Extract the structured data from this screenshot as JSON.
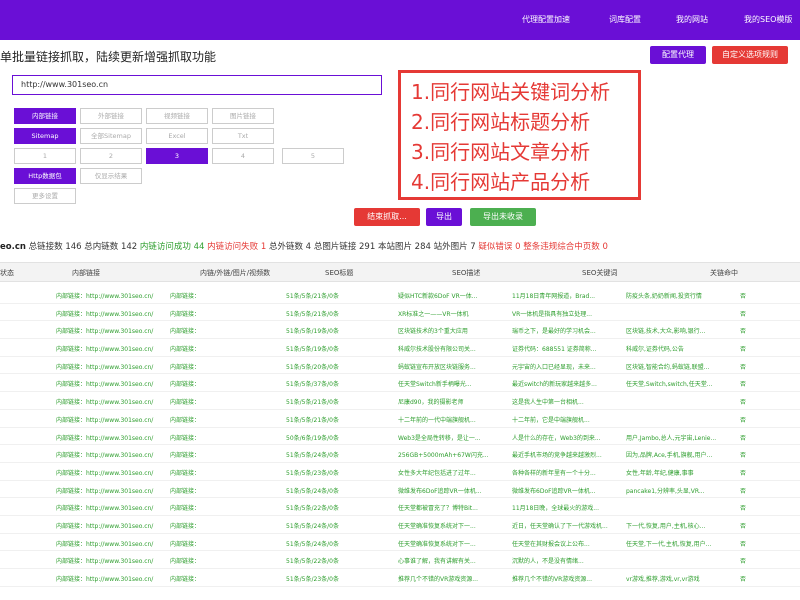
{
  "nav": [
    "代理配置加速",
    "词库配置",
    "我的网站",
    "我的SEO模版"
  ],
  "headline": "单批量链接抓取，陆续更新增强抓取功能",
  "header_buttons": [
    "配置代理",
    "自定义选项规则"
  ],
  "url_input": "http://www.301seo.cn",
  "options": [
    [
      "内部链接",
      "外部链接",
      "视频链接",
      "图片链接"
    ],
    [
      "Sitemap",
      "全部Sitemap",
      "Excel",
      "Txt"
    ],
    [
      "1",
      "2",
      "3",
      "4",
      "5"
    ],
    [
      "Http数据包",
      "仅显示结果"
    ],
    [
      "更多设置"
    ]
  ],
  "features": [
    "1.同行网站关键词分析",
    "2.同行网站标题分析",
    "3.同行网站文章分析",
    "4.同行网站产品分析"
  ],
  "actions": [
    "结束抓取...",
    "导出",
    "导出未收录"
  ],
  "stats": {
    "domain": "eo.cn",
    "total_links": "总链接数 146",
    "internal_links": "总内链数 142",
    "internal_ok": "内链访问成功 44",
    "internal_fail": "内链访问失败 1",
    "external_links": "总外链数 4",
    "total_images": "总图片链接 291",
    "site_images": "本站图片 284",
    "offsite_images": "站外图片 7",
    "suspected_404": "疑似错误 0",
    "duplicate": "整条违规综合中页数 0"
  },
  "table": {
    "headers": [
      "状态",
      "内部链接",
      "内链/外链/图片/视频数",
      "SEO标题",
      "SEO描述",
      "SEO关键词",
      "关链命中"
    ],
    "rows": [
      [
        "内部链接：http://www.301seo.cn/",
        "内部链接：",
        "51条/5条/21条/0条",
        "疑似HTC新款6DoF VR一体...",
        "11月18日青年网报道，Brad...",
        "防疫头条,奶奶新闻,投资行情",
        "否"
      ],
      [
        "内部链接：http://www.301seo.cn/",
        "内部链接：",
        "51条/5条/21条/0条",
        "XR标准之一——VR一体机",
        "VR一体机是指具有独立处理...",
        "",
        "否"
      ],
      [
        "内部链接：http://www.301seo.cn/",
        "内部链接：",
        "51条/5条/19条/0条",
        "区块链技术的3个重大应用",
        "瑞币之下，是最好的学习机会...",
        "区块链,技术,大众,影响,银行...",
        "否"
      ],
      [
        "内部链接：http://www.301seo.cn/",
        "内部链接：",
        "51条/5条/19条/0条",
        "科威尔技术股份有限公司关...",
        "证券代码：688551 证券简称...",
        "科威尔,证券代码,公告",
        "否"
      ],
      [
        "内部链接：http://www.301seo.cn/",
        "内部链接：",
        "51条/5条/20条/0条",
        "蚂蚁链宣布开放区块链服务...",
        "元宇宙的入口已经显现，未来...",
        "区块链,智能合约,蚂蚁链,联盟...",
        "否"
      ],
      [
        "内部链接：http://www.301seo.cn/",
        "内部链接：",
        "51条/5条/37条/0条",
        "任天堂Switch新手柄曝光...",
        "最近switch的新玩家越来越多...",
        "任天堂,Switch,switch,任天堂...",
        "否"
      ],
      [
        "内部链接：http://www.301seo.cn/",
        "内部链接：",
        "51条/5条/21条/0条",
        "尼康d90，我的摄影老师",
        "这是我人生中第一台相机...",
        "",
        "否"
      ],
      [
        "内部链接：http://www.301seo.cn/",
        "内部链接：",
        "51条/5条/21条/0条",
        "十二年前的一代中端旗舰机...",
        "十二年前，它是中端旗舰机...",
        "",
        "否"
      ],
      [
        "内部链接：http://www.301seo.cn/",
        "内部链接：",
        "50条/6条/19条/0条",
        "Web3是全局性转移，是让一...",
        "人是什么的存在，Web3的到来...",
        "用户,Jambo,总人,元宇宙,Lenie...",
        "否"
      ],
      [
        "内部链接：http://www.301seo.cn/",
        "内部链接：",
        "51条/5条/24条/0条",
        "256GB+5000mAh+67W闪充...",
        "最近手机市场的竞争越来越激烈...",
        "因为,品牌,Ace,手机,旗舰,用户...",
        "否"
      ],
      [
        "内部链接：http://www.301seo.cn/",
        "内部链接：",
        "51条/5条/23条/0条",
        "女性多大年纪包括进了过年...",
        "各种各样的新年里有一个十分...",
        "女性,年龄,年纪,健康,事事",
        "否"
      ],
      [
        "内部链接：http://www.301seo.cn/",
        "内部链接：",
        "51条/5条/24条/0条",
        "微维发布6DoF追踪VR一体机...",
        "微维发布6DoF追踪VR一体机...",
        "pancake1,分辨率,头显,VR...",
        "否"
      ],
      [
        "内部链接：http://www.301seo.cn/",
        "内部链接：",
        "51条/5条/22条/0条",
        "任天堂都被冒充了？博特Bit...",
        "11月18日晚，全球最火的游戏...",
        "",
        "否"
      ],
      [
        "内部链接：http://www.301seo.cn/",
        "内部链接：",
        "51条/5条/24条/0条",
        "任天堂确准恢复系统对下一...",
        "近日，任天堂确认了下一代游戏机...",
        "下一代,恢复,用户,主机,核心...",
        "否"
      ],
      [
        "内部链接：http://www.301seo.cn/",
        "内部链接：",
        "51条/5条/24条/0条",
        "任天堂确准恢复系统对下一...",
        "任天堂在其财报会议上公布...",
        "任天堂,下一代,主机,恢复,用户...",
        "否"
      ],
      [
        "内部链接：http://www.301seo.cn/",
        "内部链接：",
        "51条/5条/22条/0条",
        "心事谁了解，我有讲解有关...",
        "沉默的人，不是没有情绪...",
        "",
        "否"
      ],
      [
        "内部链接：http://www.301seo.cn/",
        "内部链接：",
        "51条/5条/23条/0条",
        "推荐几个不错的VR游戏资源...",
        "推荐几个不错的VR游戏资源...",
        "vr游戏,推荐,游戏,vr,vr游戏",
        "否"
      ]
    ]
  },
  "colors": {
    "brand": "#6a0fd6",
    "danger": "#e53935",
    "success": "#4caf50",
    "link_green": "#2e9e2e"
  }
}
